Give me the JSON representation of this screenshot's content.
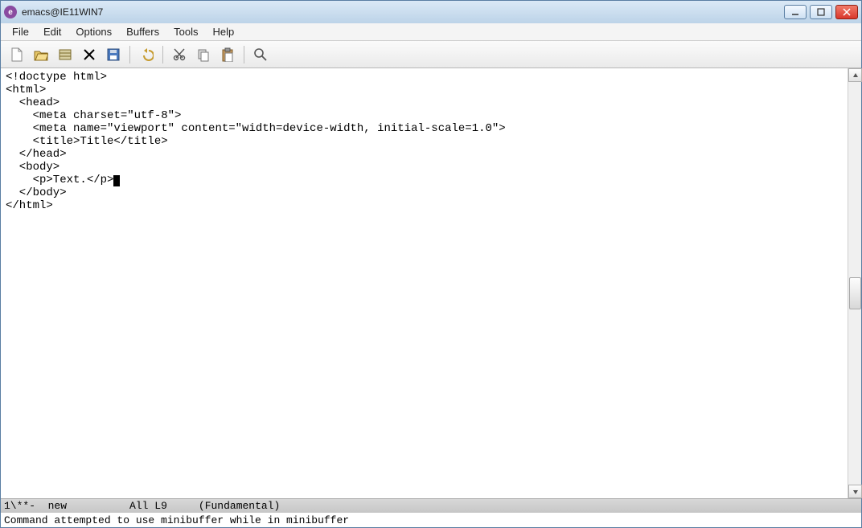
{
  "window": {
    "title": "emacs@IE11WIN7"
  },
  "menubar": [
    "File",
    "Edit",
    "Options",
    "Buffers",
    "Tools",
    "Help"
  ],
  "toolbar_icons": [
    "new-file-icon",
    "open-file-icon",
    "save-icon",
    "close-icon",
    "save-as-icon",
    "undo-icon",
    "cut-icon",
    "copy-icon",
    "paste-icon",
    "search-icon"
  ],
  "editor": {
    "lines": [
      "<!doctype html>",
      "<html>",
      "  <head>",
      "    <meta charset=\"utf-8\">",
      "    <meta name=\"viewport\" content=\"width=device-width, initial-scale=1.0\">",
      "    <title>Title</title>",
      "  </head>",
      "  <body>",
      "    <p>Text.</p>",
      "  </body>",
      "</html>"
    ],
    "cursor_line_index": 8
  },
  "modeline": {
    "modified": "1\\**-",
    "buffer": "new",
    "position": "All",
    "line": "L9",
    "mode": "(Fundamental)"
  },
  "minibuffer": "Command attempted to use minibuffer while in minibuffer"
}
